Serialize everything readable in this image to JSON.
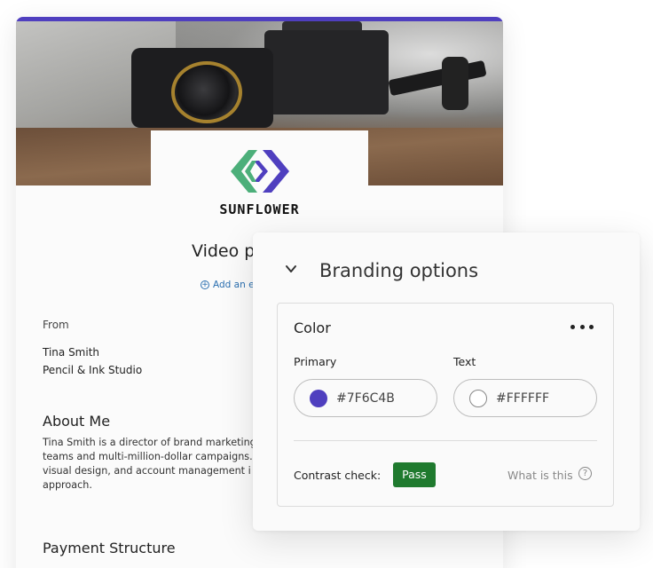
{
  "document": {
    "brand_name": "SUNFLOWER",
    "title": "Video p",
    "add_link": "Add an e",
    "from_label": "From",
    "from_name": "Tina Smith",
    "from_company": "Pencil & Ink Studio",
    "about_heading": "About Me",
    "about_text": "Tina Smith is a director of brand marketing\nteams and multi-million-dollar campaigns.\nvisual design, and account management i\napproach.",
    "payment_heading": "Payment Structure"
  },
  "branding": {
    "title": "Branding options",
    "color_section": {
      "title": "Color",
      "primary_label": "Primary",
      "primary_value": "#7F6C4B",
      "primary_color": "#4f3fbf",
      "text_label": "Text",
      "text_value": "#FFFFFF",
      "text_color": "#FFFFFF"
    },
    "contrast_label": "Contrast check:",
    "contrast_result": "Pass",
    "what_link": "What is this"
  },
  "colors": {
    "accent": "#4f3fbf",
    "pass_green": "#1f7a2e",
    "logo_green": "#4caf7a",
    "logo_purple": "#4f3fbf",
    "link_blue": "#2a6fb0"
  }
}
